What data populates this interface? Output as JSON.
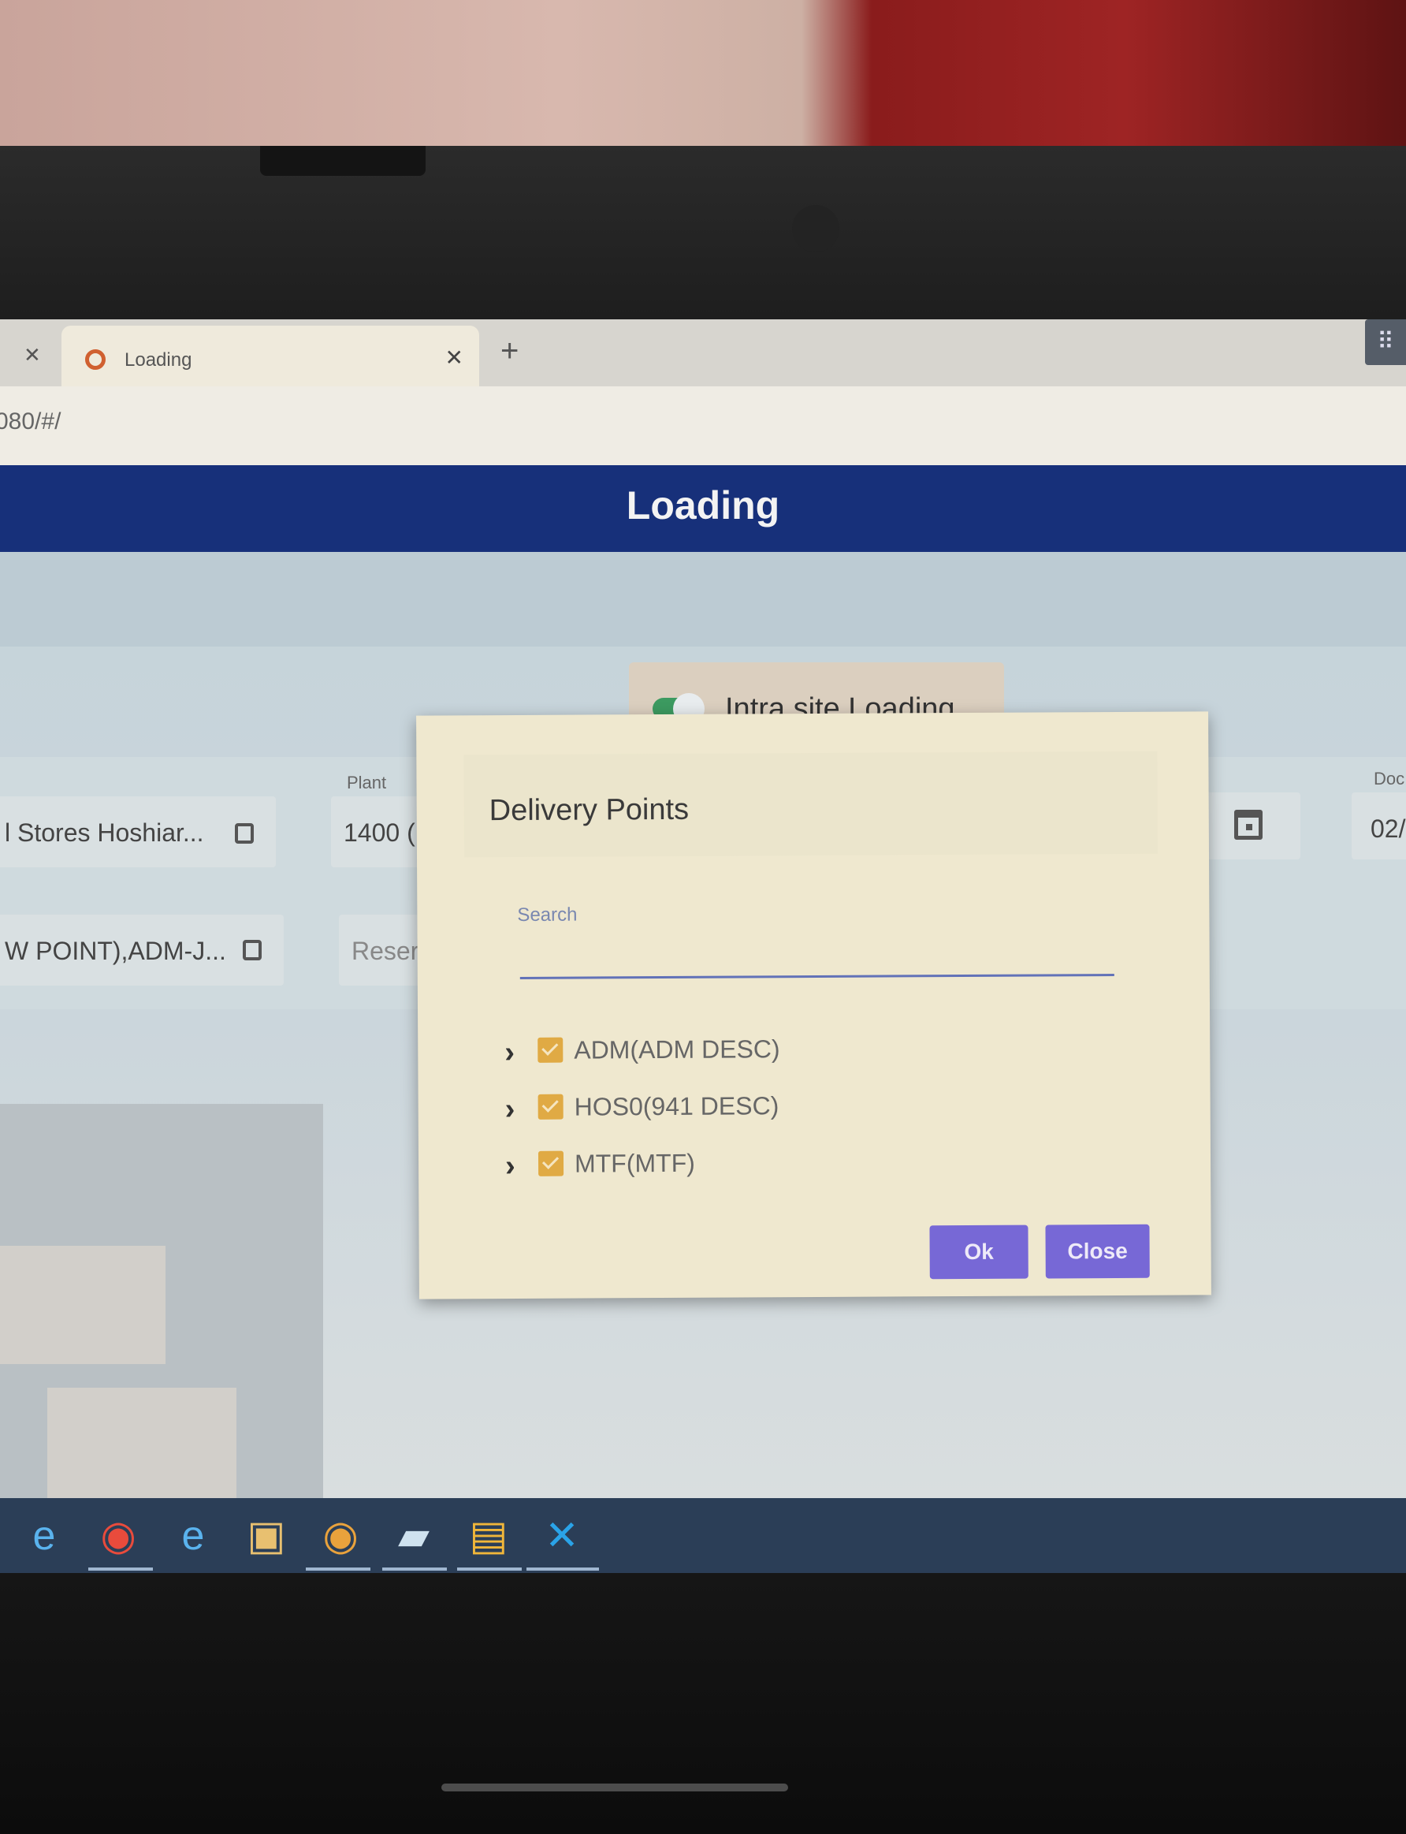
{
  "browser": {
    "tab_title": "Loading",
    "url": "080/#/"
  },
  "app": {
    "header_title": "Loading",
    "toggle_label": "Intra site Loading"
  },
  "form": {
    "store_value": "l Stores Hoshiar...",
    "plant_label": "Plant",
    "plant_value": "1400 (I",
    "delivery_value": "W POINT),ADM-J...",
    "reservation_placeholder": "Reserv",
    "doc_label": "Doc",
    "doc_value": "02/"
  },
  "dialog": {
    "title": "Delivery Points",
    "search_label": "Search",
    "search_value": "",
    "items": [
      {
        "label": "ADM(ADM DESC)",
        "checked": true
      },
      {
        "label": "HOS0(941 DESC)",
        "checked": true
      },
      {
        "label": "MTF(MTF)",
        "checked": true
      }
    ],
    "ok_label": "Ok",
    "close_label": "Close"
  },
  "taskbar": {
    "apps": [
      "internet-explorer-icon",
      "chrome-icon",
      "internet-explorer-icon",
      "media-player-icon",
      "chrome-icon",
      "notes-icon",
      "file-explorer-icon",
      "vscode-icon"
    ]
  },
  "colors": {
    "header": "#17307a",
    "dialog_bg": "#efe8cf",
    "button": "#7768d6",
    "checkbox": "#e0aa44",
    "toggle_on": "#3c9a60"
  }
}
